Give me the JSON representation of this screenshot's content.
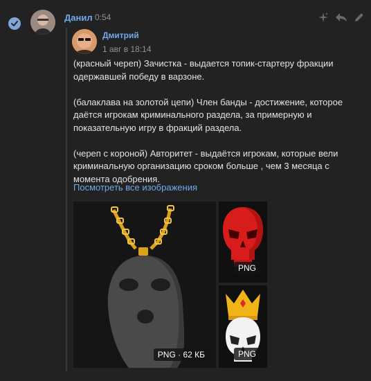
{
  "message": {
    "author": "Данил",
    "time": "0:54",
    "icons": [
      "check-icon",
      "sparkle-icon",
      "reply-icon",
      "edit-icon"
    ]
  },
  "forwarded": {
    "author": "Дмитрий",
    "date": "1 авг в 18:14",
    "paragraphs": [
      "(красный череп) Зачистка - выдается топик-стартеру фракции одержавшей победу в варзоне.",
      "(балаклава на золотой цепи) Член банды - достижение, которое даётся игрокам криминального раздела, за примерную и показательную игру в фракций раздела.",
      "(череп с короной) Авторитет - выдаётся игрокам, которые вели криминальную организацию сроком больше , чем 3 месяца с момента одобрения."
    ],
    "link": "Посмотреть все изображения",
    "attachments": [
      {
        "badge": "PNG · 62 КБ"
      },
      {
        "badge": "PNG"
      },
      {
        "badge": "PNG"
      }
    ]
  },
  "colors": {
    "background": "#222222",
    "accent": "#71aaeb",
    "text": "#e1e3e6",
    "muted": "#939393"
  }
}
